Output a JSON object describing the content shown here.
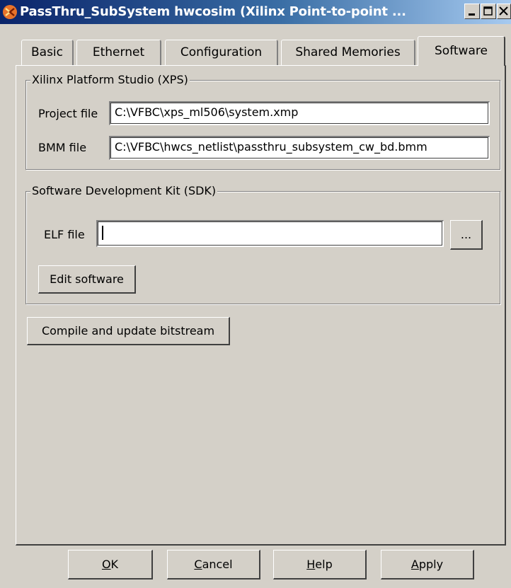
{
  "window": {
    "title": "PassThru_SubSystem hwcosim (Xilinx Point-to-point ..."
  },
  "tabs": [
    {
      "label": "Basic"
    },
    {
      "label": "Ethernet"
    },
    {
      "label": "Configuration"
    },
    {
      "label": "Shared Memories"
    },
    {
      "label": "Software",
      "active": true
    }
  ],
  "xps": {
    "legend": "Xilinx Platform Studio (XPS)",
    "project_label": "Project file",
    "project_value": "C:\\VFBC\\xps_ml506\\system.xmp",
    "bmm_label": "BMM file",
    "bmm_value": "C:\\VFBC\\hwcs_netlist\\passthru_subsystem_cw_bd.bmm"
  },
  "sdk": {
    "legend": "Software Development Kit (SDK)",
    "elf_label": "ELF file",
    "elf_value": "",
    "browse_label": "...",
    "edit_label": "Edit software"
  },
  "compile_label": "Compile and update bitstream",
  "footer": {
    "ok_mnemonic": "O",
    "ok_rest": "K",
    "cancel_mnemonic": "C",
    "cancel_rest": "ancel",
    "help_mnemonic": "H",
    "help_rest": "elp",
    "apply_mnemonic": "A",
    "apply_rest": "pply"
  },
  "icons": {
    "app": "xilinx-logo-icon",
    "minimize": "minimize-icon",
    "maximize": "maximize-icon",
    "close": "close-icon"
  }
}
